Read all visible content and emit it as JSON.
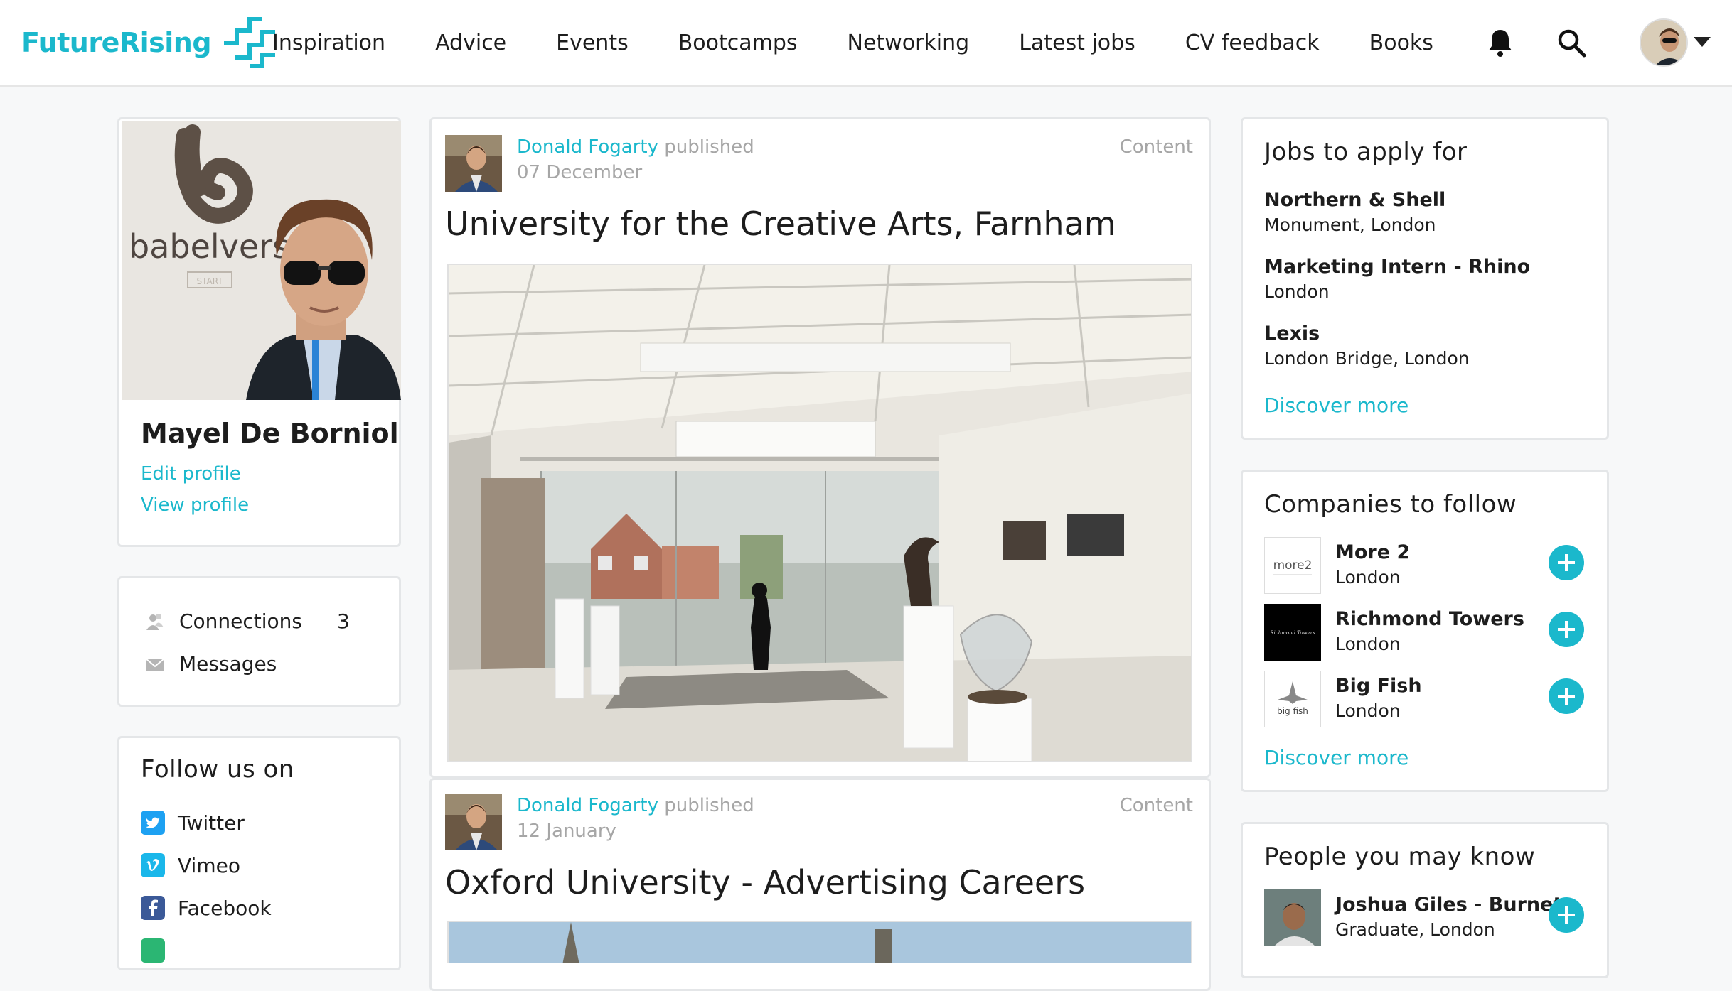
{
  "brand": {
    "name": "FutureRising",
    "accent": "#1bb8cc"
  },
  "nav": [
    "Inspiration",
    "Advice",
    "Events",
    "Bootcamps",
    "Networking",
    "Latest jobs",
    "CV feedback",
    "Books"
  ],
  "header_icons": [
    "bell-icon",
    "search-icon",
    "avatar",
    "chevron-down-icon"
  ],
  "profile": {
    "name": "Mayel De Borniol",
    "photo_sign": "babelverse",
    "photo_sub": "START",
    "edit_label": "Edit profile",
    "view_label": "View profile"
  },
  "sidebar": {
    "connections_label": "Connections",
    "connections_count": "3",
    "messages_label": "Messages"
  },
  "follow": {
    "title": "Follow us on",
    "items": [
      "Twitter",
      "Vimeo",
      "Facebook"
    ]
  },
  "posts": [
    {
      "author": "Donald Fogarty",
      "verb": "published",
      "date": "07 December",
      "tag": "Content",
      "title": "University for the Creative Arts, Farnham"
    },
    {
      "author": "Donald Fogarty",
      "verb": "published",
      "date": "12 January",
      "tag": "Content",
      "title": "Oxford University - Advertising Careers"
    }
  ],
  "jobs": {
    "title": "Jobs to apply for",
    "items": [
      {
        "title": "Northern & Shell",
        "location": "Monument, London"
      },
      {
        "title": "Marketing Intern - Rhino",
        "location": "London"
      },
      {
        "title": "Lexis",
        "location": "London Bridge, London"
      }
    ],
    "discover": "Discover more"
  },
  "companies": {
    "title": "Companies to follow",
    "items": [
      {
        "name": "More 2",
        "location": "London",
        "logo_text": "more2"
      },
      {
        "name": "Richmond Towers",
        "location": "London",
        "logo_text": "Richmond Towers"
      },
      {
        "name": "Big Fish",
        "location": "London",
        "logo_text": "big fish"
      }
    ],
    "discover": "Discover more"
  },
  "people": {
    "title": "People you may know",
    "items": [
      {
        "name": "Joshua Giles - Burnet...",
        "subtitle": "Graduate, London"
      }
    ]
  }
}
